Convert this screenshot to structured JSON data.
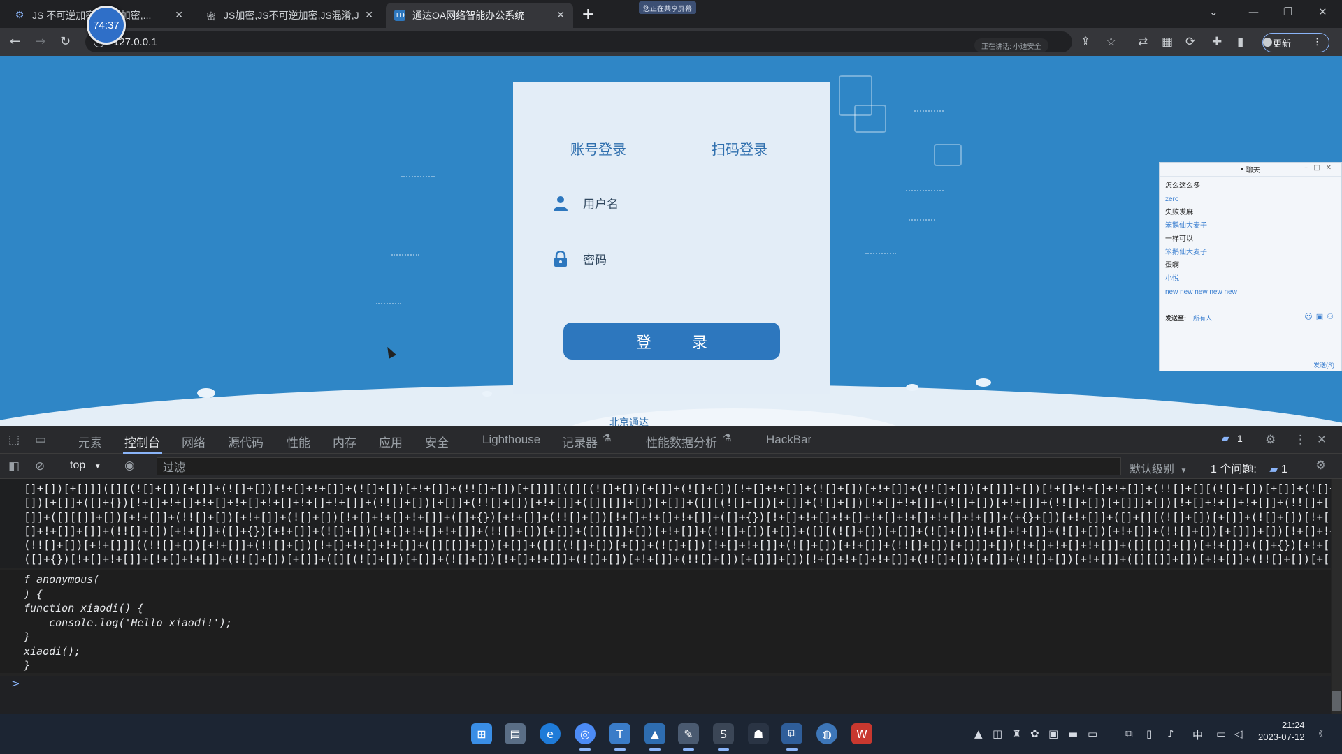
{
  "browser": {
    "tabs": [
      {
        "title": "JS 不可逆加密,Jack 加密,...",
        "favicon": "gear-icon",
        "active": false
      },
      {
        "title": "JS加密,JS不可逆加密,JS混淆,JS混...",
        "favicon": "lock-icon",
        "active": false
      },
      {
        "title": "通达OA网络智能办公系统",
        "favicon": "TD",
        "active": true
      }
    ],
    "recording_timer": "74:37",
    "share_badge": "您正在共享屏幕",
    "address": "127.0.0.1",
    "omnibox_pill": "正在讲话: 小迪安全",
    "update_label": "更新"
  },
  "page": {
    "login_tabs": [
      "账号登录",
      "扫码登录"
    ],
    "username_placeholder": "用户名",
    "password_placeholder": "密码",
    "login_button": "登 录",
    "footer_text": "北京通达"
  },
  "chat": {
    "title": "聊天",
    "messages": [
      {
        "text": "怎么这么多",
        "color": "dark"
      },
      {
        "text": "zero",
        "color": "blue"
      },
      {
        "text": "失败发麻",
        "color": "dark"
      },
      {
        "text": "笨鹅仙大麦子",
        "color": "blue"
      },
      {
        "text": "一样可以",
        "color": "dark"
      },
      {
        "text": "笨鹅仙大麦子",
        "color": "blue"
      },
      {
        "text": "蛋啊",
        "color": "dark"
      },
      {
        "text": "小悦",
        "color": "blue"
      },
      {
        "text": "new new new new new",
        "color": "blue"
      }
    ],
    "send_to_label": "发送至:",
    "send_to_value": "所有人",
    "footer": "发送(S)"
  },
  "devtools": {
    "tabs": [
      "元素",
      "控制台",
      "网络",
      "源代码",
      "性能",
      "内存",
      "应用",
      "安全",
      "Lighthouse",
      "记录器",
      "性能数据分析",
      "HackBar"
    ],
    "active_tab": "控制台",
    "message_count": "1",
    "context": "top",
    "filter_placeholder": "过滤",
    "levels": "默认级别",
    "issues_label": "1 个问题:",
    "issues_count": "1",
    "jsfuck_lines": [
      "[]+[])[+[]]]([][(![]+[])[+[]]+(![]+[])[!+[]+!+[]]+(![]+[])[+!+[]]+(!![]+[])[+[]]][([][(![]+[])[+[]]+(![]+[])[!+[]+!+[]]+(![]+[])[+!+[]]+(!![]+[])[+[]]]+[])[!+[]+!+[]+!+[]]+(!![]+[][(![]+[])[+[]]+(![]+[])[!+[]+!+[]]+(![]+[])[+!+[]]+(!![]+[])[+[]]])[+!+[]+[+[]]]+([][[]]+[])[+!+[]]+(![]+[])",
      "[])[+[]]+([]+{})[!+[]+!+[]+!+[]+!+[]+!+[]+!+[]+!+[]]+(!![]+[])[+[]]+(!![]+[])[+!+[]]+([][[]]+[])[+[]]+([][(![]+[])[+[]]+(![]+[])[!+[]+!+[]]+(![]+[])[+!+[]]+(!![]+[])[+[]]]+[])[!+[]+!+[]+!+[]]+(!![]+[])[+[]]+(!![]+[][(![]+[])[+[]]+(![]+[])[!+[]+!+[]]+(![]+[])[+!+[]]+(!![]+[])[+[]]])[+!+[]+[+[]]]",
      "[]]+([][[]]+[])[+!+[]]+(!![]+[])[+!+[]]+(![]+[])[!+[]+!+[]+!+[]]+([]+{})[+!+[]]+(!![]+[])[!+[]+!+[]+!+[]]+([]+{})[!+[]+!+[]+!+[]+!+[]+!+[]+!+[]+!+[]]+(+{}+[])[+!+[]]+([]+[][(![]+[])[+[]]+(![]+[])[!+[]+!+[]]+(![]+[])[+!+[]]+(!![]+[])[+[]]])[!+[]+!+[]+[+[]]]+([]+{})[!+[]+!+[]]+(!![]+[])[+!+[]]+(![]+[])[+!+[]]+(!![]+[])[+[]][([][[]]+[])[+!+",
      "[]+!+[]]+[]]+(!![]+[])[+!+[]]+([]+{})[+!+[]]+(![]+[])[!+[]+!+[]+!+[]]+(!![]+[])[+[]]+([][[]]+[])[+!+[]]+(!![]+[])[+[]]+([][(![]+[])[+[]]+(![]+[])[!+[]+!+[]]+(![]+[])[+!+[]]+(!![]+[])[+[]]]+[])[!+[]+!+[]+!+[]]+(!![]+[])[+[]]+(!![]+[][(![]+[])[+[]]+(![]+[])[!+[]+!+[]]+(![]+[])[+!+[]]+(!![]+[])[+[]]])[+!+[]+[+[]]]+(![]+[])[!+[]+!+",
      "(!![]+[])[+!+[]]]((!![]+[])[+!+[]]+(!![]+[])[!+[]+!+[]+!+[]]+([][[]]+[])[+[]]+([][(![]+[])[+[]]+(![]+[])[!+[]+!+[]]+(![]+[])[+!+[]]+(!![]+[])[+[]]]+[])[!+[]+!+[]+!+[]]+([][[]]+[])[+!+[]]+([]+{})[+!+[]]+(!![]+[])[+[]]+(!![]+[])[+!+[]]+(!![]+[])[!+[]+!+[]+!+[]]+(!![]+[])[+[]]+(!![]+[])[+!+[]]+(![]+[])[!+[]+!+[]+!+[]]+",
      "([]+{})[!+[]+!+[]]+[!+[]+!+[]]+(!![]+[])[+[]]+([][(![]+[])[+[]]+(![]+[])[!+[]+!+[]]+(![]+[])[+!+[]]+(!![]+[])[+[]]]+[])[!+[]+!+[]+!+[]]+(!![]+[])[+[]]+(!![]+[])[+!+[]]+([][[]]+[])[+!+[]]+(!![]+[])[+[]]+([]+{})[!+[]+!+[]+!+[]+!+[]+!+[]+!+[]+!+[]]+(+{}+[])[+!+[]]+(!![]+[])[+!+[]]+(!![]+[])[!+[]+!+[]]+(!![]+[])[+!+[]]+!!",
      "[]+([][[]]+[])[!+[]+!+[]]+(![]+[])[!+[]+!+[]]+[+!+[]]+([]+{})[!+[]+!+[]]+(+{}+[])[+!+[]]+(([]+{})[+[]]+[])[+[]]+(!![]+[])[+[]]+([][[]]+[])[+!+[]]+(!![]+[])[+[]]+([]+{})[!+[]+!+[]+!+[]+!+[]+!+[]+!+[]+!+[]]+(!![]+[])[+!+[]]+(!![]+[])[!+[]+!+[]+!+[]]+(![]+[])[!+[]+!+[]+!+[]]+(!![]+[])[+[]]+(!![]+[])[+!+[]]+(!![]+[])[!+[]+!+"
    ],
    "result_lines": [
      "f anonymous(",
      ") {",
      "function xiaodi() {",
      "    console.log('Hello xiaodi!');",
      "}",
      "xiaodi();",
      "}"
    ],
    "prompt": ">"
  },
  "taskbar": {
    "apps": [
      "windows-logo",
      "file-explorer",
      "edge",
      "chrome",
      "typora",
      "app-mountain",
      "notes",
      "sublime",
      "cat",
      "virtualbox",
      "browser-globe",
      "wechat-work"
    ],
    "clock_time": "21:24",
    "clock_date": "2023-07-12",
    "ime": "中"
  }
}
